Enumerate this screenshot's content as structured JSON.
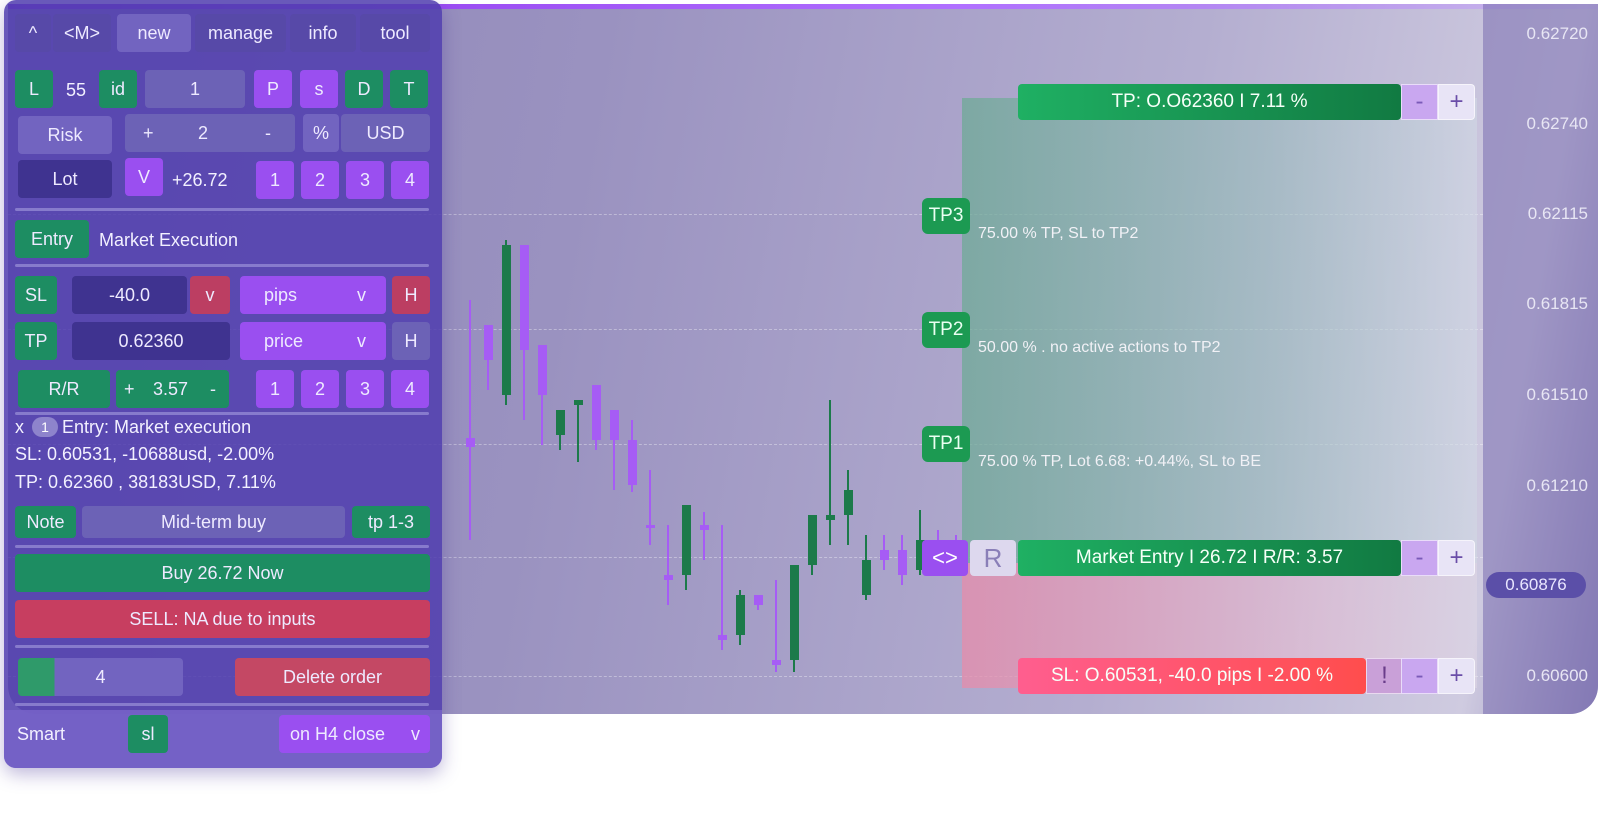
{
  "chart": {
    "price_levels": [
      "0.62720",
      "0.62740",
      "0.62115",
      "0.61815",
      "0.61510",
      "0.61210",
      "0.60600"
    ],
    "current_price": "0.60876",
    "tp_bar": "TP: O.O62360 I 7.11 %",
    "entry_bar": "Market Entry I 26.72 I R/R: 3.57",
    "sl_bar": "SL: O.60531, -40.0 pips I -2.00 %",
    "minus": "-",
    "plus": "+",
    "alert": "!",
    "drag_handle": "<>",
    "reset": "R",
    "tp3": {
      "tag": "TP3",
      "text": "75.00 % TP, SL to TP2"
    },
    "tp2": {
      "tag": "TP2",
      "text": "50.00 % . no active actions to TP2"
    },
    "tp1": {
      "tag": "TP1",
      "text": "75.00 % TP, Lot 6.68: +0.44%, SL to BE"
    },
    "colors": {
      "buy": "#1d9a58",
      "sell": "#ff4d6d",
      "accent": "#9a4ff0",
      "bull_candle": "#1c7a4a",
      "bear_candle": "#a65cf5"
    },
    "candles": [
      [
        470,
        300,
        438,
        447,
        540
      ],
      [
        488,
        355,
        325,
        360,
        390
      ],
      [
        506,
        240,
        395,
        245,
        405
      ],
      [
        524,
        345,
        245,
        350,
        420
      ],
      [
        542,
        345,
        345,
        395,
        445
      ],
      [
        560,
        420,
        435,
        410,
        450
      ],
      [
        578,
        440,
        405,
        400,
        462
      ],
      [
        596,
        425,
        385,
        440,
        450
      ],
      [
        614,
        438,
        410,
        440,
        490
      ],
      [
        632,
        420,
        440,
        485,
        492
      ],
      [
        650,
        470,
        525,
        528,
        545
      ],
      [
        668,
        525,
        575,
        580,
        605
      ],
      [
        686,
        515,
        575,
        505,
        590
      ],
      [
        704,
        512,
        525,
        530,
        560
      ],
      [
        722,
        525,
        635,
        640,
        650
      ],
      [
        740,
        590,
        635,
        595,
        645
      ],
      [
        758,
        595,
        595,
        605,
        610
      ],
      [
        776,
        580,
        660,
        665,
        672
      ],
      [
        794,
        565,
        660,
        565,
        672
      ],
      [
        812,
        515,
        565,
        515,
        575
      ],
      [
        830,
        400,
        520,
        515,
        545
      ],
      [
        848,
        470,
        515,
        490,
        545
      ],
      [
        866,
        535,
        595,
        560,
        600
      ],
      [
        884,
        535,
        550,
        560,
        570
      ],
      [
        902,
        535,
        550,
        575,
        585
      ],
      [
        920,
        510,
        570,
        540,
        575
      ],
      [
        938,
        530,
        540,
        550,
        555
      ],
      [
        956,
        535,
        542,
        550,
        560
      ]
    ]
  },
  "panel": {
    "top_nav": [
      "^",
      "<M>",
      "new",
      "manage",
      "info",
      "tool"
    ],
    "row1": {
      "l": "L",
      "num": "55",
      "id": "id",
      "value": "1",
      "p": "P",
      "s": "s",
      "d": "D",
      "t": "T"
    },
    "risk": {
      "label": "Risk",
      "plus": "+",
      "value": "2",
      "minus": "-",
      "pct": "%",
      "currency": "USD"
    },
    "lot": {
      "label": "Lot",
      "v": "V",
      "value": "+26.72",
      "presets": [
        "1",
        "2",
        "3",
        "4"
      ]
    },
    "entry": {
      "label": "Entry",
      "value": "Market Execution"
    },
    "sl": {
      "label": "SL",
      "value": "-40.0",
      "v": "v",
      "unit": "pips",
      "unit_v": "v",
      "h": "H"
    },
    "tp": {
      "label": "TP",
      "value": "0.62360",
      "unit": "price",
      "unit_v": "v",
      "h": "H"
    },
    "rr": {
      "label": "R/R",
      "plus": "+",
      "value": "3.57",
      "minus": "-",
      "presets": [
        "1",
        "2",
        "3",
        "4"
      ]
    },
    "summary": {
      "x": "x",
      "badge": "1",
      "line1": "Entry: Market execution",
      "line2": "SL: 0.60531, -10688usd, -2.00%",
      "line3": "TP: 0.62360 , 38183USD, 7.11%"
    },
    "note": {
      "label": "Note",
      "value": "Mid-term buy",
      "tag": "tp 1-3"
    },
    "buy_button": "Buy 26.72 Now",
    "sell_button": "SELL: NA due to inputs",
    "order_count": "4",
    "delete_button": "Delete order",
    "smart": {
      "label": "Smart",
      "sl": "sl",
      "mode": "on H4 close",
      "mode_v": "v"
    }
  }
}
